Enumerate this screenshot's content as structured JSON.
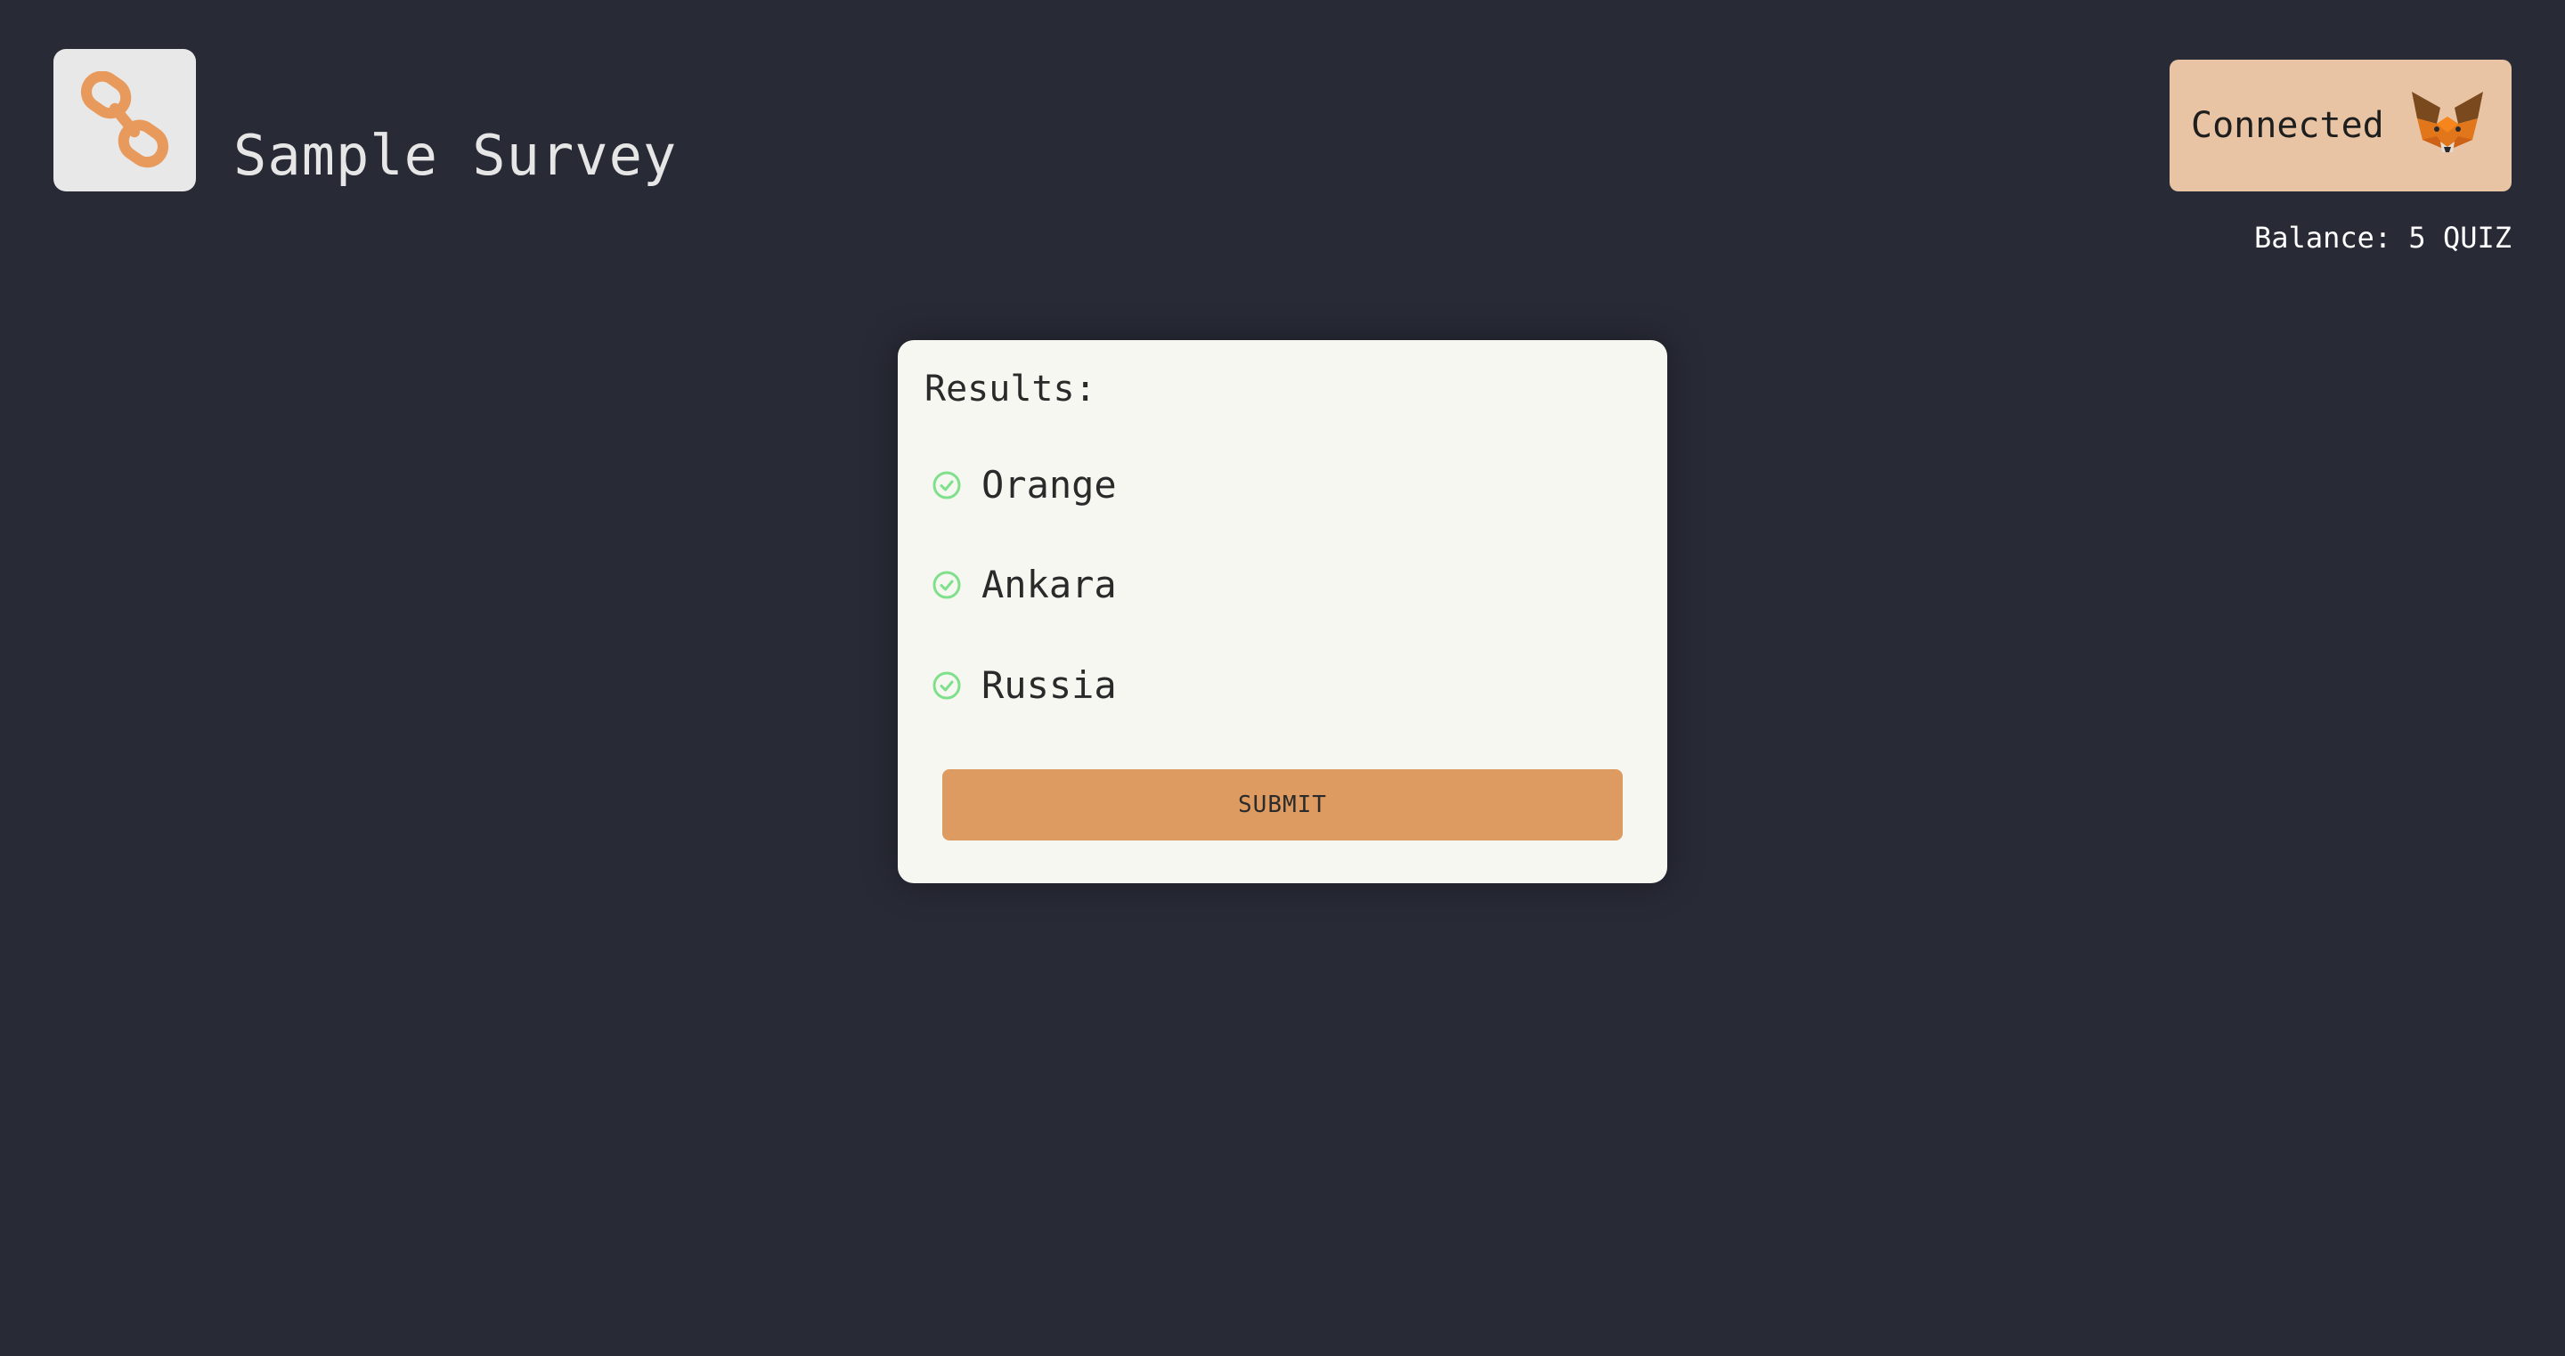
{
  "header": {
    "logo_icon": "chain-link-icon",
    "title": "Sample Survey",
    "wallet": {
      "label": "Connected",
      "icon": "metamask-fox-icon",
      "color": "#e8c4a4"
    },
    "balance": "Balance: 5 QUIZ"
  },
  "results": {
    "title": "Results:",
    "items": [
      {
        "label": "Orange",
        "icon": "check-circle-icon"
      },
      {
        "label": "Ankara",
        "icon": "check-circle-icon"
      },
      {
        "label": "Russia",
        "icon": "check-circle-icon"
      }
    ],
    "submit_label": "SUBMIT"
  },
  "colors": {
    "background": "#282a36",
    "accent": "#dd9b61",
    "card": "#f7f7f2",
    "check": "#7ee08a"
  }
}
